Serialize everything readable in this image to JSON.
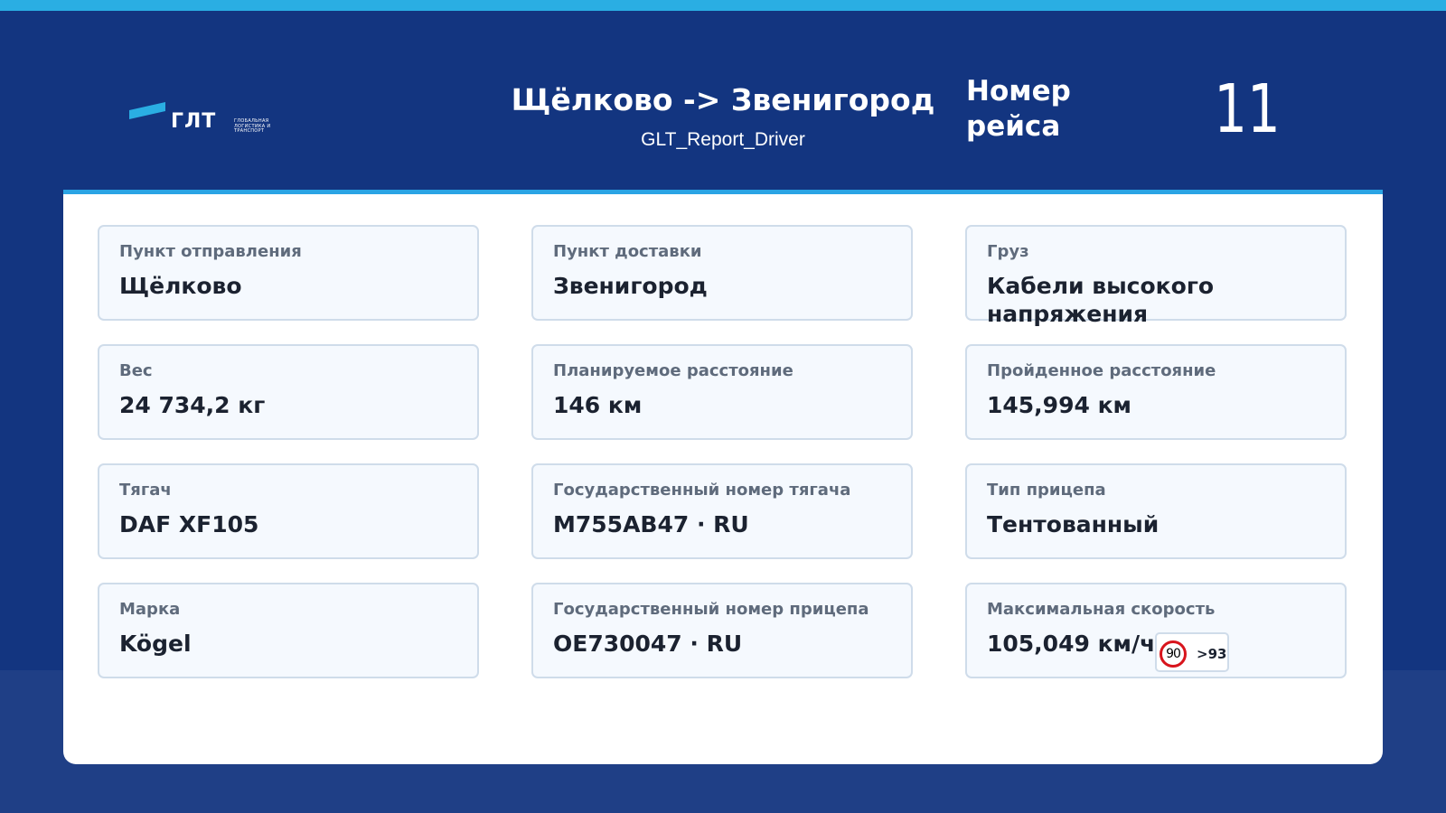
{
  "header": {
    "logo": {
      "main_text": "ГЛТ",
      "sub_text": "ГЛОБАЛЬНАЯ ЛОГИСТИКА И ТРАНСПОРТ",
      "stripe_color": "#2aaee3"
    },
    "route_title": "Щёлково -> Звенигород",
    "report_name": "GLT_Report_Driver",
    "trip_label": "Номер рейса",
    "trip_number": "11"
  },
  "colors": {
    "top_strip": "#2aaee3",
    "header_background": "#133580",
    "page_background": "#1f3f86",
    "panel_accent": "#2aa4e4",
    "card_background": "#f5f9fe",
    "card_border": "#cfdcea",
    "label_text": "#5f6b7c",
    "value_text": "#1b2230",
    "speed_sign_ring": "#d8141c"
  },
  "cards": [
    {
      "label": "Пункт отправления",
      "value": "Щёлково"
    },
    {
      "label": "Пункт доставки",
      "value": "Звенигород"
    },
    {
      "label": "Груз",
      "value": "Кабели высокого напряжения"
    },
    {
      "label": "Вес",
      "value": "24 734,2 кг"
    },
    {
      "label": "Планируемое расстояние",
      "value": "146 км"
    },
    {
      "label": "Пройденное расстояние",
      "value": "145,994 км"
    },
    {
      "label": "Тягач",
      "value": "DAF XF105"
    },
    {
      "label": "Государственный номер тягача",
      "value": "M755AB47 · RU"
    },
    {
      "label": "Тип прицепа",
      "value": "Тентованный"
    },
    {
      "label": "Марка",
      "value": "Kögel"
    },
    {
      "label": "Государственный номер прицепа",
      "value": "OE730047 · RU"
    },
    {
      "label": "Максимальная скорость",
      "value": "105,049 км/ч"
    }
  ],
  "speed_limit": {
    "sign_icon": "speed-limit-sign-icon",
    "limit": "90",
    "exceeded": ">93"
  }
}
